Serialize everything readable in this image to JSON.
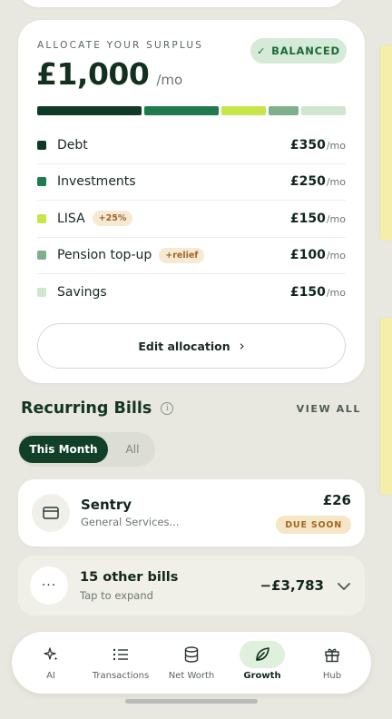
{
  "surplus": {
    "eyebrow": "ALLOCATE YOUR SURPLUS",
    "status_badge": "BALANCED",
    "amount": "£1,000",
    "amount_unit": "/mo",
    "edit_label": "Edit allocation",
    "allocations": [
      {
        "name": "Debt",
        "value": "£350",
        "unit": "/mo",
        "color": "#0f3a26",
        "tag": "",
        "share": 350
      },
      {
        "name": "Investments",
        "value": "£250",
        "unit": "/mo",
        "color": "#1f7a4d",
        "tag": "",
        "share": 250
      },
      {
        "name": "LISA",
        "value": "£150",
        "unit": "/mo",
        "color": "#c6e64a",
        "tag": "+25%",
        "share": 150
      },
      {
        "name": "Pension top-up",
        "value": "£100",
        "unit": "/mo",
        "color": "#7fb08c",
        "tag": "+relief",
        "share": 100
      },
      {
        "name": "Savings",
        "value": "£150",
        "unit": "/mo",
        "color": "#cfe6d0",
        "tag": "",
        "share": 150
      }
    ]
  },
  "bills": {
    "title": "Recurring Bills",
    "view_all": "VIEW ALL",
    "tabs": [
      "This Month",
      "All"
    ],
    "active_tab": 0,
    "items": [
      {
        "name": "Sentry",
        "category": "General Services...",
        "amount": "£26",
        "status": "DUE SOON"
      }
    ],
    "collapsed": {
      "title": "15 other bills",
      "subtitle": "Tap to expand",
      "amount": "−£3,783"
    }
  },
  "nav": {
    "items": [
      {
        "label": "AI",
        "icon": "sparkle-icon"
      },
      {
        "label": "Transactions",
        "icon": "list-icon"
      },
      {
        "label": "Net Worth",
        "icon": "database-icon"
      },
      {
        "label": "Growth",
        "icon": "leaf-icon"
      },
      {
        "label": "Hub",
        "icon": "gift-icon"
      }
    ],
    "active": "Growth"
  },
  "colors": {
    "brand_dark": "#113f27",
    "accent_green_bg": "#d6ead8",
    "warning_bg": "#f6e6c6",
    "warning_text": "#a06521"
  }
}
